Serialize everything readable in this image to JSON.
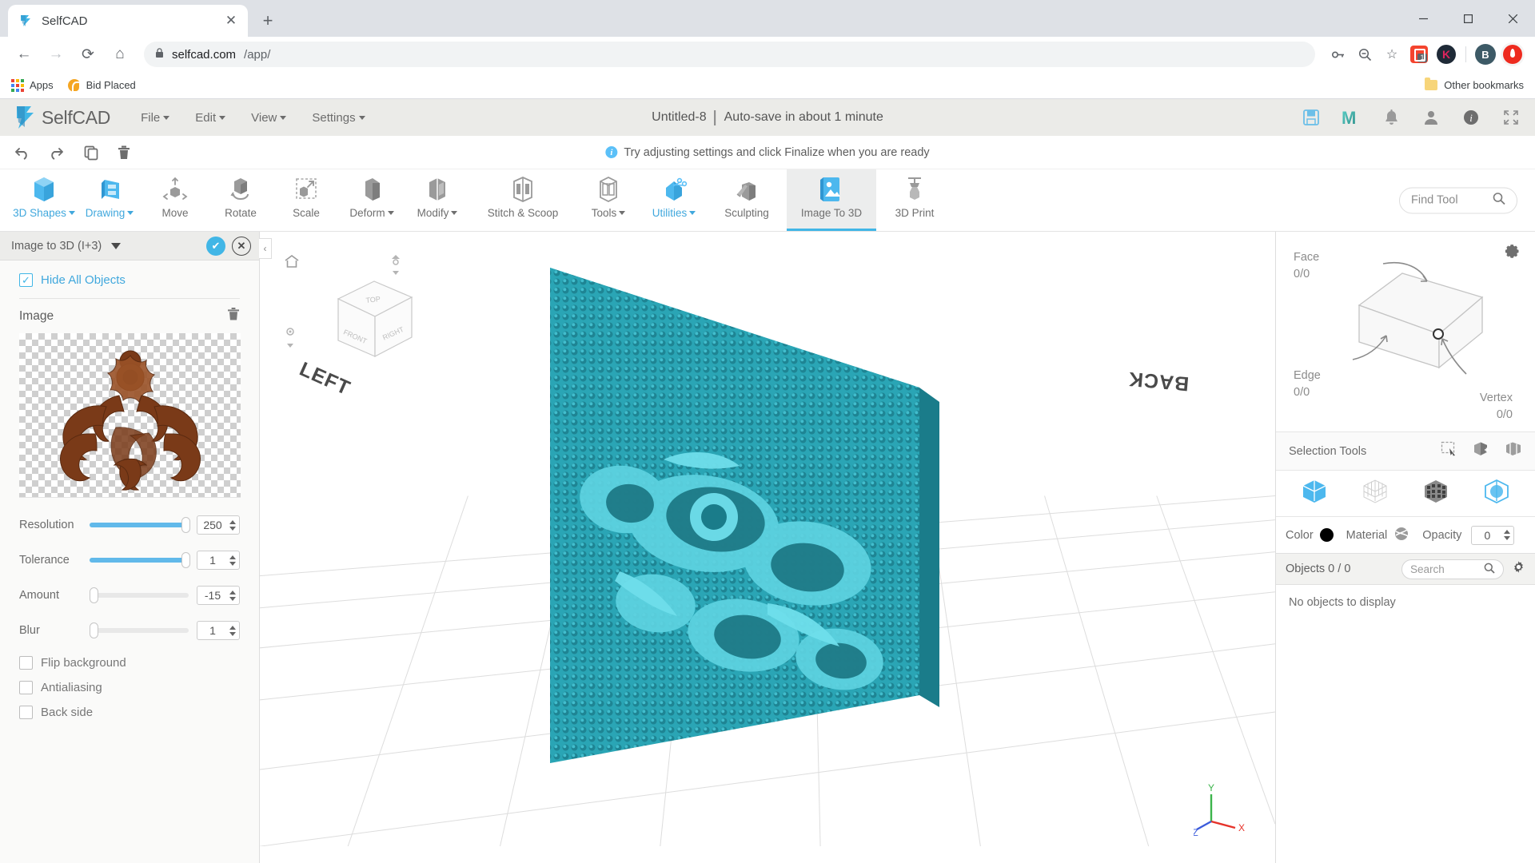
{
  "browser": {
    "tab": {
      "title": "SelfCAD",
      "favicon": "selfcad-logo-icon",
      "close": "✕"
    },
    "new_tab": "+",
    "window_controls": {
      "minimize": "—",
      "maximize": "▢",
      "close": "✕"
    },
    "nav": {
      "back": "←",
      "forward": "→",
      "reload": "⟳",
      "home": "⌂"
    },
    "omnibox": {
      "lock": "🔒",
      "domain": "selfcad.com",
      "path": "/app/"
    },
    "toolbar_icons": {
      "password": "key-icon",
      "zoom_out": "zoom-out-icon",
      "bookmark": "☆",
      "extension_badge": "1",
      "avatar_k": "K",
      "avatar_b": "B"
    },
    "bookmarks": {
      "apps": "Apps",
      "bid_placed": "Bid Placed",
      "other": "Other bookmarks"
    }
  },
  "app": {
    "logo_text": "SelfCAD",
    "menus": [
      "File",
      "Edit",
      "View",
      "Settings"
    ],
    "document": {
      "name": "Untitled-8",
      "autosave": "Auto-save in about 1 minute"
    },
    "header_icons": [
      "save-icon",
      "magic-m-icon",
      "bell-icon",
      "user-icon",
      "info-icon",
      "fullscreen-icon"
    ],
    "history_icons": [
      "undo-icon",
      "redo-icon",
      "copy-icon",
      "delete-icon"
    ],
    "hint": "Try adjusting settings and click Finalize when you are ready",
    "find_tool": {
      "placeholder": "Find Tool",
      "icon": "search-icon"
    },
    "toolbar": [
      {
        "label": "3D Shapes",
        "icon": "cube-blue-icon",
        "dropdown": true,
        "blue": true,
        "active": false
      },
      {
        "label": "Drawing",
        "icon": "drawing-pen-icon",
        "dropdown": true,
        "blue": true,
        "active": false
      },
      {
        "label": "Move",
        "icon": "move-arrows-icon",
        "dropdown": false,
        "blue": false,
        "active": false
      },
      {
        "label": "Rotate",
        "icon": "rotate-icon",
        "dropdown": false,
        "blue": false,
        "active": false
      },
      {
        "label": "Scale",
        "icon": "scale-icon",
        "dropdown": false,
        "blue": false,
        "active": false
      },
      {
        "label": "Deform",
        "icon": "deform-icon",
        "dropdown": true,
        "blue": false,
        "active": false
      },
      {
        "label": "Modify",
        "icon": "modify-icon",
        "dropdown": true,
        "blue": false,
        "active": false
      },
      {
        "label": "Stitch & Scoop",
        "icon": "stitch-scoop-icon",
        "dropdown": false,
        "blue": false,
        "active": false
      },
      {
        "label": "Tools",
        "icon": "tools-icon",
        "dropdown": true,
        "blue": false,
        "active": false
      },
      {
        "label": "Utilities",
        "icon": "utilities-scissors-icon",
        "dropdown": true,
        "blue": true,
        "active": false
      },
      {
        "label": "Sculpting",
        "icon": "sculpting-icon",
        "dropdown": false,
        "blue": false,
        "active": false
      },
      {
        "label": "Image To 3D",
        "icon": "image-to-3d-icon",
        "dropdown": false,
        "blue": true,
        "active": true
      },
      {
        "label": "3D Print",
        "icon": "3d-print-icon",
        "dropdown": false,
        "blue": false,
        "active": false
      }
    ]
  },
  "left_panel": {
    "title": "Image to 3D (I+3)",
    "confirm": "✔",
    "cancel": "✕",
    "hide_all_objects": {
      "label": "Hide All Objects",
      "checked": true
    },
    "image_section": {
      "title": "Image",
      "delete_icon": "trash-icon",
      "preview": "floral-ornament-carving"
    },
    "sliders": [
      {
        "label": "Resolution",
        "value": "250",
        "percent": 97
      },
      {
        "label": "Tolerance",
        "value": "1",
        "percent": 97
      },
      {
        "label": "Amount",
        "value": "-15",
        "percent": 0
      },
      {
        "label": "Blur",
        "value": "1",
        "percent": 0
      }
    ],
    "checkboxes": [
      {
        "label": "Flip background",
        "checked": false
      },
      {
        "label": "Antialiasing",
        "checked": false
      },
      {
        "label": "Back side",
        "checked": false
      }
    ],
    "collapse": "‹"
  },
  "viewport": {
    "home_icon": "home-icon",
    "labels": {
      "left": "LEFT",
      "back": "BACK"
    },
    "cube_faces": {
      "top": "TOP",
      "front": "FRONT",
      "right": "RIGHT"
    },
    "axes": {
      "x": "X",
      "y": "Y",
      "z": "Z"
    },
    "model_color": "#2aa5b5"
  },
  "right_panel": {
    "gear_icon": "gear-icon",
    "selection": {
      "face": {
        "label": "Face",
        "value": "0/0"
      },
      "edge": {
        "label": "Edge",
        "value": "0/0"
      },
      "vertex": {
        "label": "Vertex",
        "value": "0/0"
      }
    },
    "selection_tools": {
      "title": "Selection Tools",
      "icons": [
        "rectangle-select-icon",
        "add-select-icon",
        "box-select-icon"
      ]
    },
    "view_modes": [
      "solid-view-icon",
      "wireframe-view-icon",
      "mesh-view-icon",
      "transparent-view-icon"
    ],
    "material": {
      "color_label": "Color",
      "color_value": "#000000",
      "material_label": "Material",
      "material_icon": "sphere-material-icon",
      "opacity_label": "Opacity",
      "opacity_value": "0"
    },
    "objects": {
      "count_label": "Objects 0 / 0",
      "search_placeholder": "Search",
      "gear_icon": "gear-icon",
      "empty": "No objects to display"
    }
  }
}
